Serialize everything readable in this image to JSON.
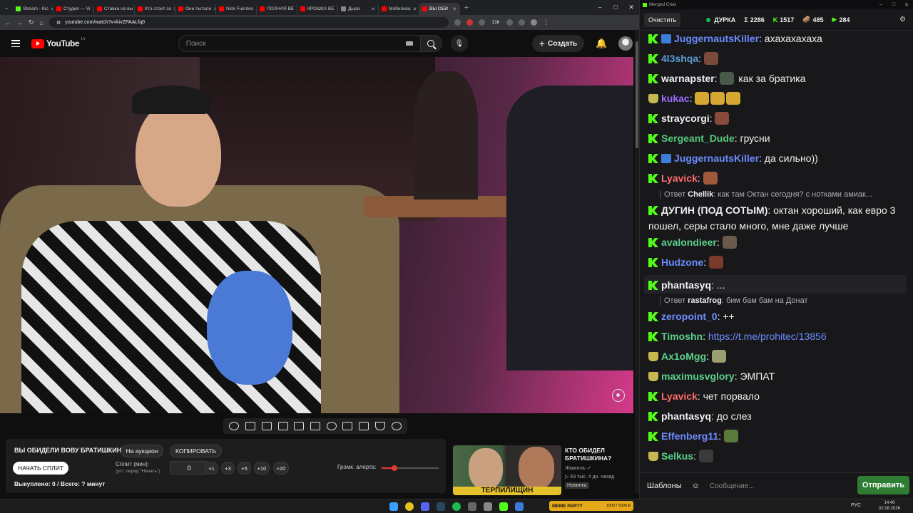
{
  "browser": {
    "tabs": [
      {
        "label": "Stream - Kic",
        "color": "#53fc18"
      },
      {
        "label": "Студия — Vi",
        "color": "#ff0000"
      },
      {
        "label": "Ставка на вы",
        "color": "#ff0000"
      },
      {
        "label": "Кто стоит за",
        "color": "#ff0000"
      },
      {
        "label": "Они пытали",
        "color": "#ff0000"
      },
      {
        "label": "Nick Fuentes",
        "color": "#ff0000"
      },
      {
        "label": "ПОЛНАЯ ВЕ",
        "color": "#ff0000"
      },
      {
        "label": "КРОШКА ВЕ",
        "color": "#ff0000"
      },
      {
        "label": "Дыра",
        "color": "#888888"
      },
      {
        "label": "Мобилиза",
        "color": "#ff0000"
      },
      {
        "label": "ВЫ ОБИ",
        "color": "#ff0000"
      }
    ],
    "url": "youtube.com/watch?v=kivZPAALfq0",
    "ext_badge": "216"
  },
  "youtube": {
    "logo_text": "YouTube",
    "country": "LV",
    "search_placeholder": "Поиск",
    "create_label": "Создать"
  },
  "panel": {
    "title": "ВЫ ОБИДЕЛИ ВОВУ БРАТИШКИНА",
    "auction_btn": "На аукцион",
    "copy_btn": "КОПИРОВАТЬ",
    "start_btn": "НАЧАТЬ СПЛИТ",
    "split_label": "Сплит (мин):",
    "split_hint": "(уст. перед \"Начать\")",
    "split_value": "0",
    "increments": [
      "+1",
      "+3",
      "+5",
      "+10",
      "+20"
    ],
    "alert_label": "Громк. алерта:",
    "alert_volume": 0.22,
    "bought": "Выкуплено: 0 / Всего: ? минут"
  },
  "recommendation": {
    "title": "КТО ОБИДЕЛ БРАТИШКИНА?",
    "channel": "Жмилль ✓",
    "meta": "▷ 63 тыс.  4 дн. назад",
    "badge": "Новинка",
    "thumb_text": "ТЕРПИЛИЩИН"
  },
  "taskbar": {
    "lang": "РУС",
    "time": "14:46",
    "date": "02.08.2026",
    "alert_widget": "MEME PARTY",
    "alert_counter": "1800 / 5000 ₽"
  },
  "chat": {
    "window_title": "Merged Chat",
    "clear_label": "Очистить",
    "stream_name": "ДУРКА",
    "stats": [
      {
        "icon": "Σ",
        "value": "2286"
      },
      {
        "icon": "K",
        "value": "1517"
      },
      {
        "icon": "🥔",
        "value": "485"
      },
      {
        "icon": "▶",
        "value": "284"
      }
    ],
    "messages": [
      {
        "badge": "k",
        "badge2": "plane",
        "user": "JuggernautsKiller",
        "color": "#6b8cff",
        "text": ": ахахахахаха",
        "emotes": []
      },
      {
        "badge": "k",
        "user": "4l3shqa",
        "color": "#5b9bd5",
        "text": ": ",
        "emotes": [
          "#7a4a3a"
        ]
      },
      {
        "badge": "k",
        "user": "warnapster",
        "color": "#efeff1",
        "text": " как за братика",
        "emotes": [
          "#4a5a4a"
        ]
      },
      {
        "badge": "crown",
        "user": "kukac",
        "color": "#9b6bff",
        "text": ": ",
        "emotes": [
          "#d6a832",
          "#d6a832",
          "#d6a832"
        ]
      },
      {
        "badge": "k",
        "user": "straycorgi",
        "color": "#efeff1",
        "text": ": ",
        "emotes": [
          "#8a4a3a"
        ]
      },
      {
        "badge": "k",
        "user": "Sergeant_Dude",
        "color": "#53c77a",
        "text": ": грусни",
        "emotes": []
      },
      {
        "badge": "k",
        "badge2": "plane",
        "user": "JuggernautsKiller",
        "color": "#6b8cff",
        "text": ": да сильно))",
        "emotes": []
      },
      {
        "badge": "k",
        "user": "Lyavick",
        "color": "#ff6b6b",
        "text": ": ",
        "emotes": [
          "#a0583a"
        ]
      },
      {
        "badge": "k",
        "user": "ДУГИН (ПОД СОТЫМ)",
        "color": "#efeff1",
        "text": ": октан хороший, как евро 3 пошел, серы стало много, мне даже лучше",
        "emotes": []
      },
      {
        "badge": "k",
        "user": "avalondieer",
        "color": "#5ad18a",
        "text": ": ",
        "emotes": [
          "#6a5a4a"
        ]
      },
      {
        "badge": "k",
        "user": "Hudzone",
        "color": "#6b8cff",
        "text": ": ",
        "emotes": [
          "#7a3a2a"
        ]
      },
      {
        "badge": "k",
        "user": "phantasyq",
        "color": "#efeff1",
        "text": ": ...",
        "emotes": []
      },
      {
        "badge": "k",
        "user": "zeropoint_0",
        "color": "#6b8cff",
        "text": ": ++",
        "emotes": []
      },
      {
        "badge": "k",
        "user": "Timoshn",
        "color": "#5ad18a",
        "text": ": ",
        "link": "https://t.me/prohitec/13856",
        "emotes": []
      },
      {
        "badge": "crown",
        "user": "Ax1oMgg",
        "color": "#5ad18a",
        "text": ": ",
        "emotes": [
          "#9aa070"
        ]
      },
      {
        "badge": "crown",
        "user": "maximusvglory",
        "color": "#5ad18a",
        "text": ": ЭМПАТ",
        "emotes": []
      },
      {
        "badge": "k",
        "user": "Lyavick",
        "color": "#ff6b6b",
        "text": ": чет порвало",
        "emotes": []
      },
      {
        "badge": "k",
        "user": "phantasyq",
        "color": "#efeff1",
        "text": ": до слез",
        "emotes": []
      },
      {
        "badge": "k",
        "user": "Effenberg11",
        "color": "#6b8cff",
        "text": ": ",
        "emotes": [
          "#5a7a3a"
        ]
      },
      {
        "badge": "crown",
        "user": "Selkus",
        "color": "#5ad18a",
        "text": ": ",
        "emotes": [
          "#3a3a3a"
        ]
      }
    ],
    "replies": [
      {
        "prefix": "Ответ",
        "user": "Chellik",
        "text": ": как там Октан сегодня? с нотками амиак..."
      },
      {
        "prefix": "Ответ",
        "user": "rastafrog",
        "text": ": бим бам бам на Донат"
      }
    ],
    "templates_label": "Шаблоны",
    "message_placeholder": "Сообщение...",
    "send_label": "Отправить"
  }
}
